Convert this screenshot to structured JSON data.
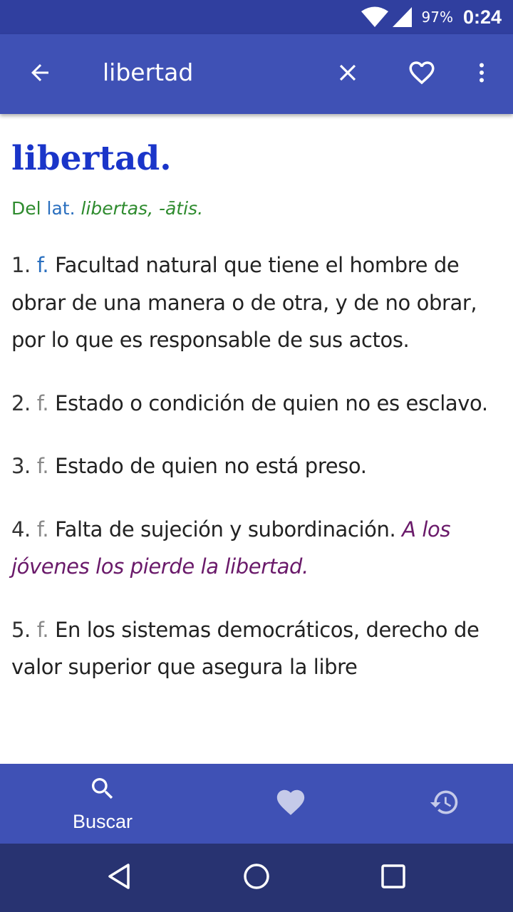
{
  "status_bar": {
    "battery_percent": "97%",
    "time": "0:24",
    "icons": [
      "wifi-icon",
      "signal-icon",
      "battery-icon"
    ]
  },
  "app_bar": {
    "search_query": "libertad",
    "icons": [
      "back-arrow-icon",
      "close-icon",
      "heart-outline-icon",
      "more-vert-icon"
    ]
  },
  "entry": {
    "headword": "libertad.",
    "etymology": {
      "prefix": "Del",
      "abbr": "lat.",
      "latin": "libertas, -ātis."
    },
    "senses": [
      {
        "num": "1.",
        "gram": "f.",
        "text": "Facultad natural que tiene el hombre de obrar de una manera o de otra, y de no obrar, por lo que es responsable de sus actos.",
        "example": ""
      },
      {
        "num": "2.",
        "gram": "f.",
        "text": "Estado o condición de quien no es esclavo.",
        "example": ""
      },
      {
        "num": "3.",
        "gram": "f.",
        "text": "Estado de quien no está preso.",
        "example": ""
      },
      {
        "num": "4.",
        "gram": "f.",
        "text": "Falta de sujeción y subordinación.",
        "example": "A los jóvenes los pierde la libertad."
      },
      {
        "num": "5.",
        "gram": "f.",
        "text": "En los sistemas democráticos, derecho de valor superior que asegura la libre",
        "example": ""
      }
    ]
  },
  "bottom_nav": {
    "items": [
      {
        "icon": "search-icon",
        "label": "Buscar",
        "active": true
      },
      {
        "icon": "heart-icon",
        "label": "",
        "active": false
      },
      {
        "icon": "history-icon",
        "label": "",
        "active": false
      }
    ]
  },
  "system_nav": {
    "icons": [
      "back-triangle-icon",
      "home-circle-icon",
      "recents-square-icon"
    ]
  },
  "colors": {
    "status_bar": "#303f9f",
    "app_bar": "#3f51b5",
    "headword": "#1a35c9",
    "etymology": "#2e8b2e",
    "abbreviation": "#2a6fbf",
    "example": "#6a1a6a",
    "system_nav": "#283371"
  }
}
